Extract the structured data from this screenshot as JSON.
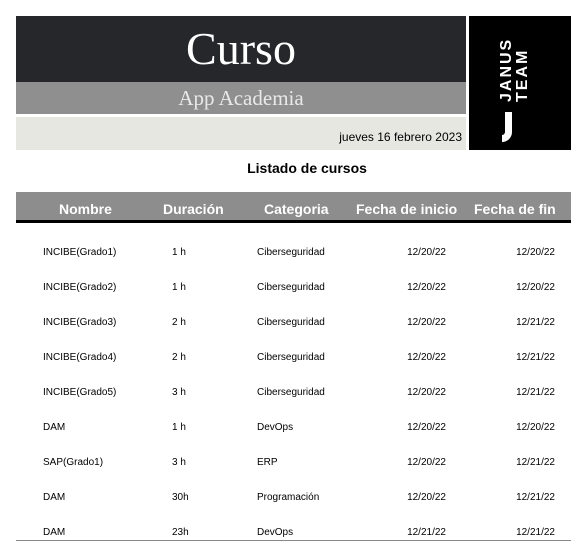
{
  "header": {
    "title": "Curso",
    "subtitle": "App Academia",
    "date": "jueves 16 febrero 2023",
    "logo_line1": "JANUS",
    "logo_line2": "TEAM"
  },
  "listing_title": "Listado de cursos",
  "table": {
    "columns": [
      "Nombre",
      "Duración",
      "Categoria",
      "Fecha de inicio",
      "Fecha de fin"
    ],
    "rows": [
      {
        "nombre": "INCIBE(Grado1)",
        "duracion": "1  h",
        "categoria": "Ciberseguridad",
        "inicio": "12/20/22",
        "fin": "12/20/22"
      },
      {
        "nombre": "INCIBE(Grado2)",
        "duracion": "1  h",
        "categoria": "Ciberseguridad",
        "inicio": "12/20/22",
        "fin": "12/20/22"
      },
      {
        "nombre": "INCIBE(Grado3)",
        "duracion": "2  h",
        "categoria": "Ciberseguridad",
        "inicio": "12/20/22",
        "fin": "12/21/22"
      },
      {
        "nombre": "INCIBE(Grado4)",
        "duracion": "2  h",
        "categoria": "Ciberseguridad",
        "inicio": "12/20/22",
        "fin": "12/21/22"
      },
      {
        "nombre": "INCIBE(Grado5)",
        "duracion": "3  h",
        "categoria": "Ciberseguridad",
        "inicio": "12/20/22",
        "fin": "12/21/22"
      },
      {
        "nombre": "DAM",
        "duracion": "1  h",
        "categoria": "DevOps",
        "inicio": "12/20/22",
        "fin": "12/20/22"
      },
      {
        "nombre": "SAP(Grado1)",
        "duracion": "3  h",
        "categoria": "ERP",
        "inicio": "12/20/22",
        "fin": "12/21/22"
      },
      {
        "nombre": "DAM",
        "duracion": "30h",
        "categoria": "Programación",
        "inicio": "12/20/22",
        "fin": "12/21/22"
      },
      {
        "nombre": "DAM",
        "duracion": "23h",
        "categoria": "DevOps",
        "inicio": "12/21/22",
        "fin": "12/21/22"
      }
    ]
  }
}
